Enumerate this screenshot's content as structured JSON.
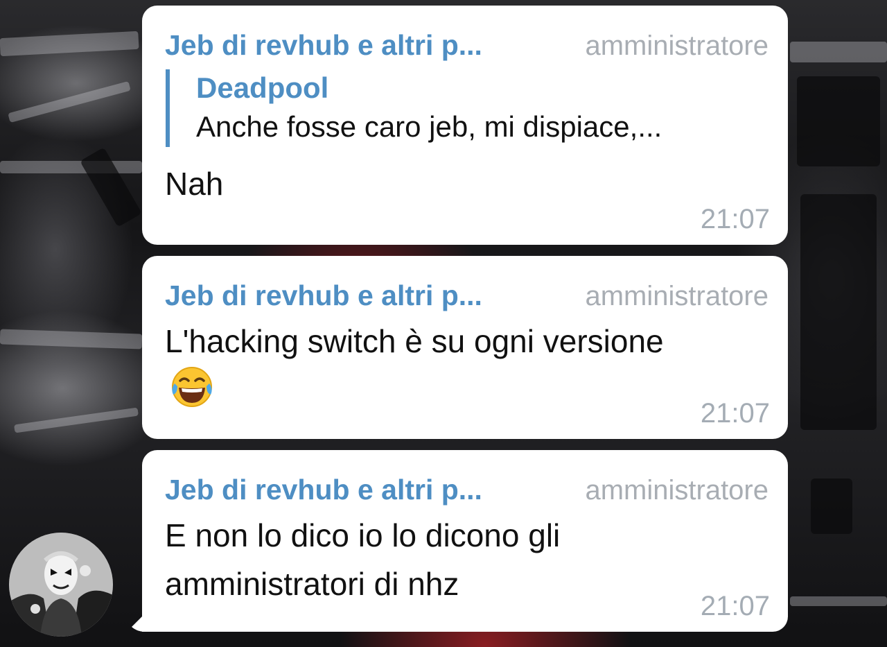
{
  "chat": {
    "messages": [
      {
        "sender": "Jeb di revhub e altri p...",
        "role": "amministratore",
        "reply": {
          "author": "Deadpool",
          "text": "Anche fosse caro jeb, mi dispiace,..."
        },
        "text": "Nah",
        "time": "21:07"
      },
      {
        "sender": "Jeb di revhub e altri p...",
        "role": "amministratore",
        "text": "L'hacking switch è su ogni versione",
        "emoji": "face-with-tears-of-joy",
        "time": "21:07"
      },
      {
        "sender": "Jeb di revhub e altri p...",
        "role": "amministratore",
        "text": "E non lo dico io lo dicono gli amministratori di nhz",
        "time": "21:07"
      }
    ]
  },
  "colors": {
    "sender": "#4e8ec3",
    "role": "#a8adb3",
    "time": "#a4acb4",
    "bubble": "#ffffff"
  }
}
